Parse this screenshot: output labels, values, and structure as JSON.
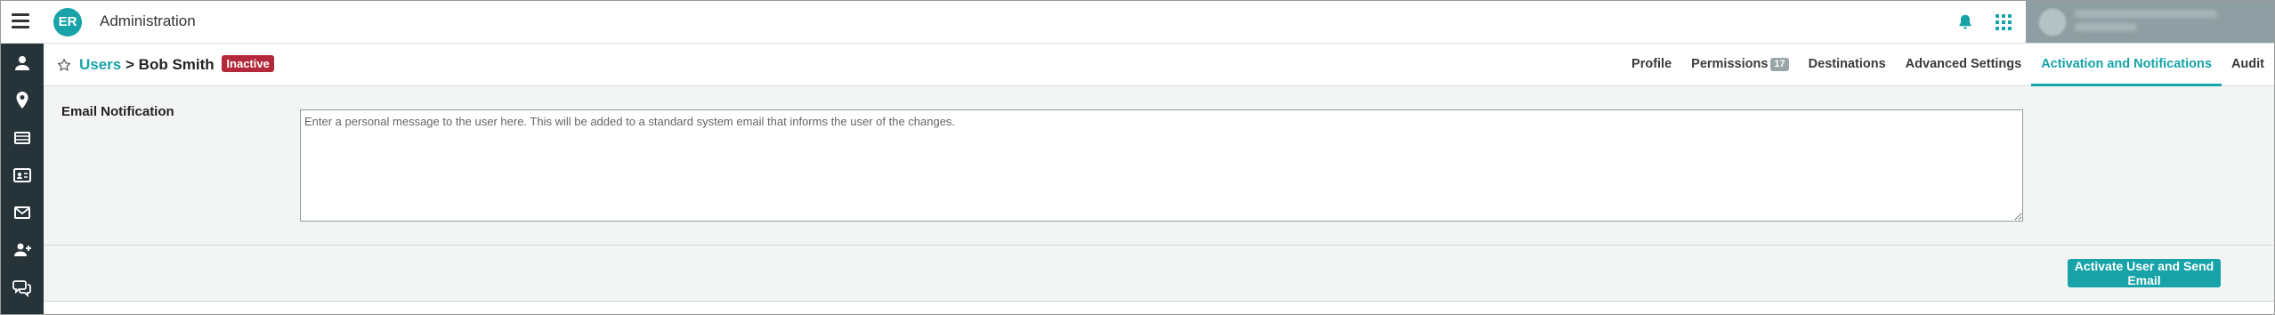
{
  "app": {
    "logo_text": "ER",
    "title": "Administration"
  },
  "topbar": {
    "menu_icon": "hamburger-menu-icon",
    "notification_icon": "bell-icon",
    "apps_icon": "app-grid-icon",
    "user_avatar_icon": "user-avatar-icon"
  },
  "sidebar": {
    "items": [
      {
        "icon": "person-icon"
      },
      {
        "icon": "location-pin-icon"
      },
      {
        "icon": "film-icon"
      },
      {
        "icon": "id-card-icon"
      },
      {
        "icon": "envelope-icon"
      },
      {
        "icon": "add-user-icon"
      },
      {
        "icon": "chat-bubbles-icon"
      }
    ]
  },
  "breadcrumb": {
    "root": "Users",
    "separator": ">",
    "current": "Bob Smith",
    "status": "Inactive"
  },
  "tabs": [
    {
      "label": "Profile",
      "active": false
    },
    {
      "label": "Permissions",
      "count": "17",
      "active": false
    },
    {
      "label": "Destinations",
      "active": false
    },
    {
      "label": "Advanced Settings",
      "active": false
    },
    {
      "label": "Activation and Notifications",
      "active": true
    },
    {
      "label": "Audit",
      "active": false
    }
  ],
  "form": {
    "email_label": "Email Notification",
    "message_placeholder": "Enter a personal message to the user here. This will be added to a standard system email that informs the user of the changes.",
    "message_value": ""
  },
  "actions": {
    "activate_label": "Activate User and Send Email"
  },
  "colors": {
    "accent": "#17a3a8",
    "sidebar": "#26343a",
    "inactive_badge": "#b3283a"
  }
}
